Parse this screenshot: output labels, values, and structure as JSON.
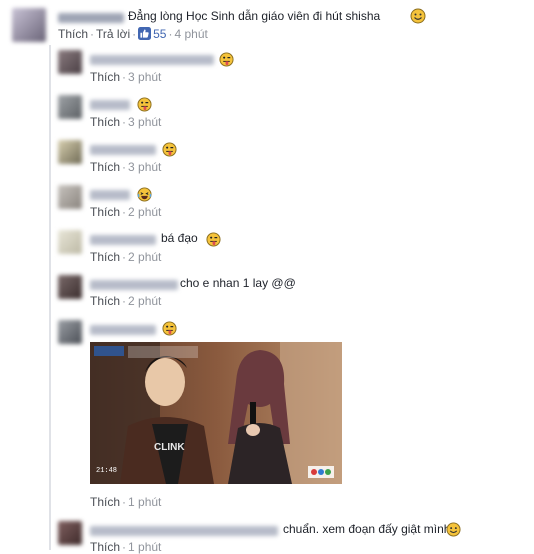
{
  "thread": {
    "main_comment": {
      "author": "Hoàng Phúc",
      "text": "Đẳng lòng Học Sinh dẫn giáo viên đi hút shisha",
      "emoji": "smile-emoji",
      "actions": {
        "like": "Thích",
        "reply": "Trả lời",
        "likes": "55",
        "time": "4 phút"
      }
    },
    "replies": [
      {
        "author": "Nguyễn Thảo Trâm",
        "text": "",
        "emoji": "tongue-emoji",
        "like": "Thích",
        "time": "3 phút"
      },
      {
        "author": "Ba Hà",
        "text": "",
        "emoji": "tongue-emoji",
        "like": "Thích",
        "time": "3 phút"
      },
      {
        "author": "Hoàng Minh",
        "text": "",
        "emoji": "tongue-emoji",
        "like": "Thích",
        "time": "3 phút"
      },
      {
        "author": "Lê My",
        "text": "",
        "emoji": "laugh-cry-emoji",
        "like": "Thích",
        "time": "2 phút"
      },
      {
        "author": "Minh Quân",
        "text": "bá đạo",
        "emoji": "tongue-emoji",
        "like": "Thích",
        "time": "2 phút"
      },
      {
        "author": "Vũ Duy Nghĩa",
        "text": "cho e nhan 1 lay @@",
        "emoji": "",
        "like": "Thích",
        "time": "2 phút"
      },
      {
        "author": "Trần Huy",
        "text": "",
        "emoji": "tongue-emoji",
        "like": "Thích",
        "time": "1 phút",
        "photo": "tv-scene-photo"
      },
      {
        "author": "Ân Phương Trần Tường",
        "text": "chuẩn. xem đoạn đấy giật mình",
        "emoji": "smile-emoji",
        "like": "Thích",
        "time": "1 phút"
      }
    ]
  },
  "colors": {
    "link": "#4b4f56",
    "time": "#90949c",
    "like_blue": "#4267b2",
    "emoji_yellow": "#f5c33b"
  }
}
